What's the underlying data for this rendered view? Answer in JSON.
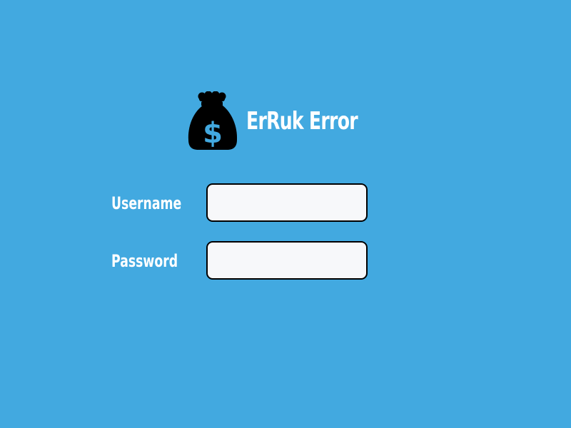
{
  "app": {
    "title": "ErRuk Error",
    "logo_icon": "money-bag-dollar-icon"
  },
  "form": {
    "username": {
      "label": "Username",
      "value": "",
      "placeholder": ""
    },
    "password": {
      "label": "Password",
      "value": "",
      "placeholder": ""
    }
  },
  "colors": {
    "background": "#42a9e0",
    "text": "#ffffff",
    "icon": "#000000",
    "icon_symbol": "#42a9e0",
    "input_background": "#f7f8fa",
    "input_border": "#000000"
  }
}
